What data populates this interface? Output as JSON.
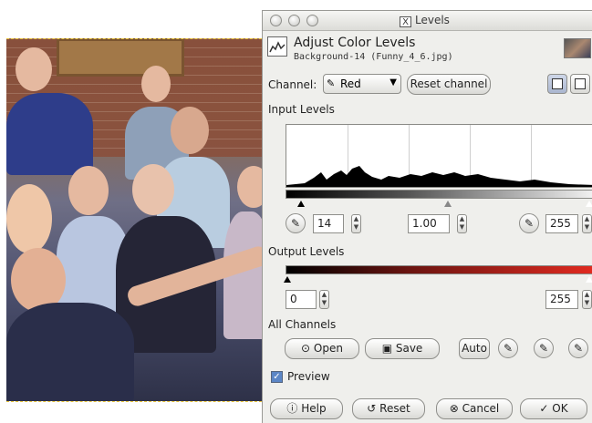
{
  "window": {
    "title": "Levels"
  },
  "header": {
    "title": "Adjust Color Levels",
    "subtitle": "Background-14 (Funny_4_6.jpg)"
  },
  "channel": {
    "label": "Channel:",
    "selected": "Red",
    "reset_label": "Reset channel"
  },
  "input_levels": {
    "label": "Input Levels",
    "low": "14",
    "gamma": "1.00",
    "high": "255"
  },
  "output_levels": {
    "label": "Output Levels",
    "low": "0",
    "high": "255"
  },
  "all_channels": {
    "label": "All Channels",
    "open_label": "Open",
    "save_label": "Save",
    "auto_label": "Auto"
  },
  "preview": {
    "label": "Preview",
    "checked": true
  },
  "buttons": {
    "help": "Help",
    "reset": "Reset",
    "cancel": "Cancel",
    "ok": "OK"
  },
  "icons": {
    "window_controls": [
      "close-icon",
      "minimize-icon",
      "maximize-icon"
    ],
    "x11": "x11-icon",
    "dropper": "eyedropper-icon"
  },
  "colors": {
    "output_gradient_end": "#e02a20",
    "preview_check": "#5b86c6"
  }
}
